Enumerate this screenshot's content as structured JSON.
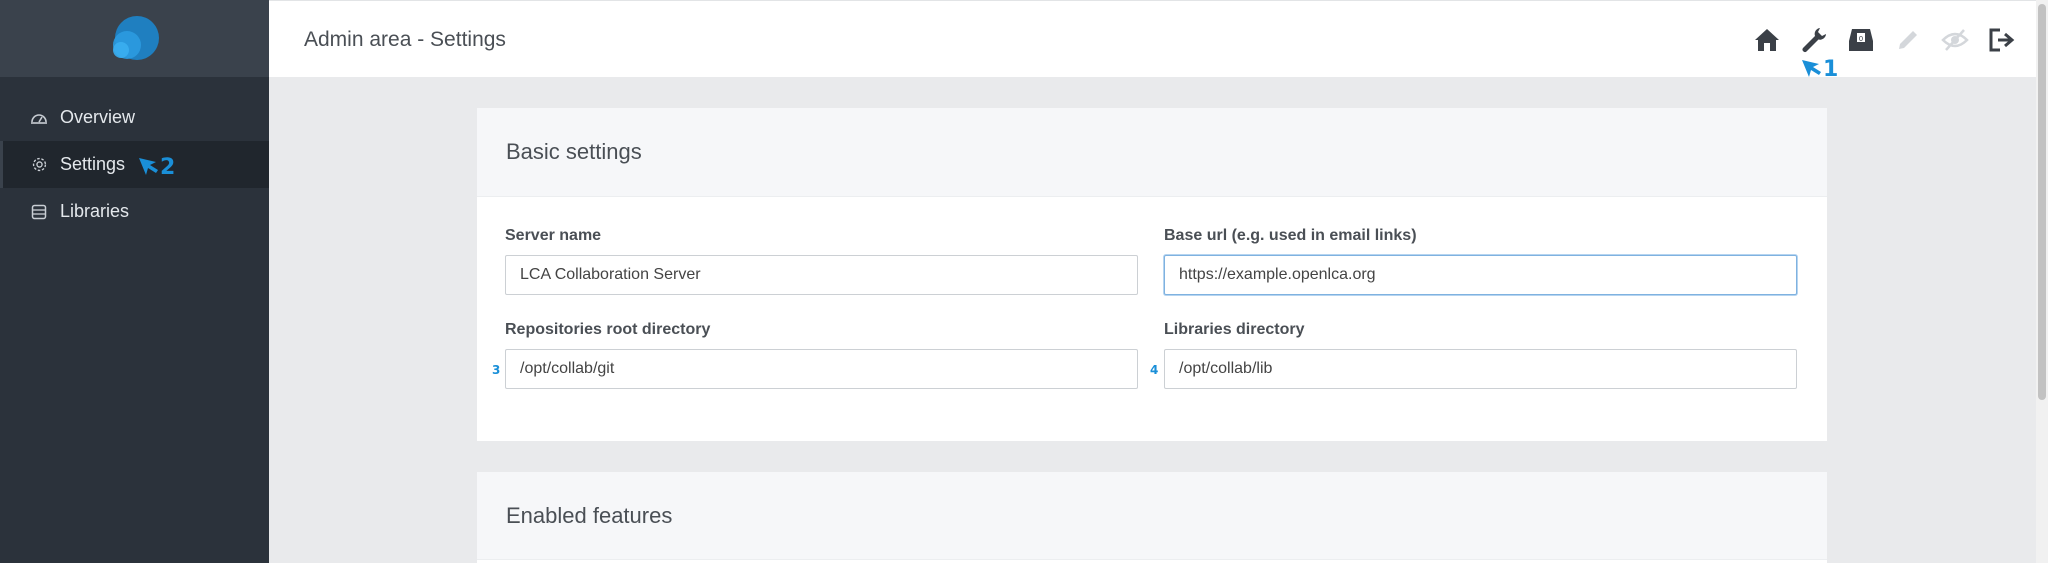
{
  "sidebar": {
    "logo": "app-logo",
    "items": [
      {
        "label": "Overview",
        "icon": "dashboard-icon"
      },
      {
        "label": "Settings",
        "icon": "gear-icon"
      },
      {
        "label": "Libraries",
        "icon": "database-icon"
      }
    ]
  },
  "header": {
    "title": "Admin area - Settings",
    "icons": [
      "home-icon",
      "wrench-icon",
      "inbox-icon",
      "edit-icon",
      "eye-slash-icon",
      "sign-out-icon"
    ]
  },
  "basic_settings": {
    "title": "Basic settings",
    "server_name": {
      "label": "Server name",
      "value": "LCA Collaboration Server"
    },
    "base_url": {
      "label": "Base url (e.g. used in email links)",
      "value": "https://example.openlca.org"
    },
    "repo_root": {
      "label": "Repositories root directory",
      "value": "/opt/collab/git"
    },
    "lib_dir": {
      "label": "Libraries directory",
      "value": "/opt/collab/lib"
    }
  },
  "enabled_features": {
    "title": "Enabled features"
  },
  "annotations": {
    "m1": "1",
    "m2": "2",
    "m3": "3",
    "m4": "4"
  },
  "colors": {
    "sidebar": "#2b323b",
    "accent": "#1a8fd8",
    "header_bg": "#ffffff"
  }
}
